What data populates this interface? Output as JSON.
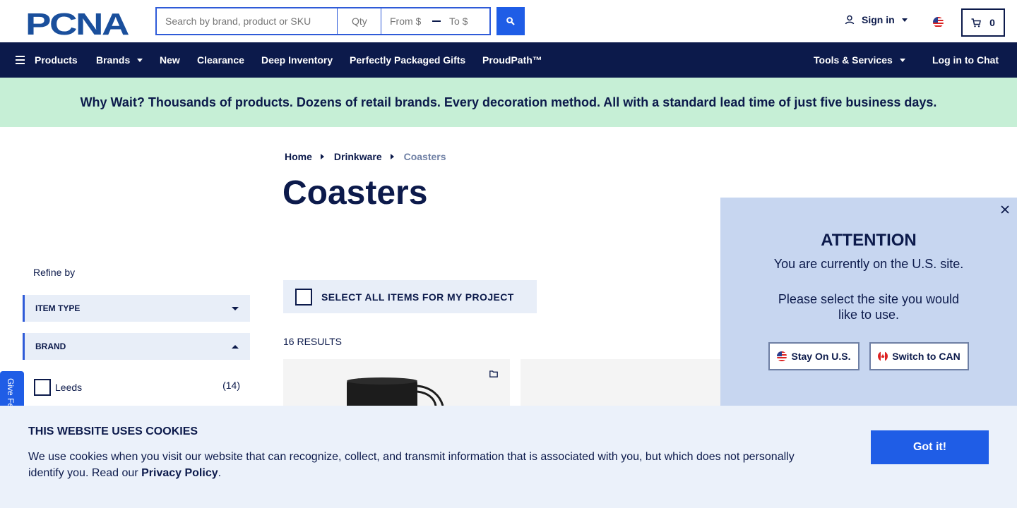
{
  "header": {
    "logo_text": "PCNA",
    "search_placeholder": "Search by brand, product or SKU",
    "qty_placeholder": "Qty",
    "from_placeholder": "From $",
    "to_placeholder": "To $",
    "signin_label": "Sign in",
    "cart_count": "0"
  },
  "nav": {
    "products": "Products",
    "brands": "Brands",
    "new": "New",
    "clearance": "Clearance",
    "deep_inventory": "Deep Inventory",
    "gifts": "Perfectly Packaged Gifts",
    "proudpath": "ProudPath™",
    "tools": "Tools & Services",
    "chat": "Log in to Chat"
  },
  "promo": "Why Wait? Thousands of products. Dozens of retail brands. Every decoration method. All with a standard lead time of just five business days.",
  "breadcrumb": {
    "home": "Home",
    "drinkware": "Drinkware",
    "current": "Coasters"
  },
  "page_title": "Coasters",
  "sidebar": {
    "refine_label": "Refine by",
    "filters": [
      {
        "label": "ITEM TYPE",
        "expanded": false
      },
      {
        "label": "BRAND",
        "expanded": true
      }
    ],
    "brands": [
      {
        "name": "Leeds",
        "count": "(14)"
      }
    ],
    "feedback_label": "Give Feedback"
  },
  "content": {
    "select_all_label": "SELECT ALL ITEMS FOR MY PROJECT",
    "results_label": "16 RESULTS"
  },
  "attention": {
    "title": "ATTENTION",
    "message": "You are currently on the U.S. site.",
    "prompt": "Please select the site you would like to use.",
    "stay_label": "Stay On U.S.",
    "switch_label": "Switch to CAN"
  },
  "cookie": {
    "title": "THIS WEBSITE USES COOKIES",
    "text": "We use cookies when you visit our website that can recognize, collect, and transmit information that is associated with you, but which does not personally identify you. Read our ",
    "link": "Privacy Policy",
    "period": ".",
    "button": "Got it!"
  },
  "colors": {
    "navy": "#0c1a4b",
    "accent_blue": "#1f5de6",
    "promo_green": "#c6efd6",
    "popup_bg": "#c7d6f0",
    "cookie_bg": "#ebf1fa"
  }
}
